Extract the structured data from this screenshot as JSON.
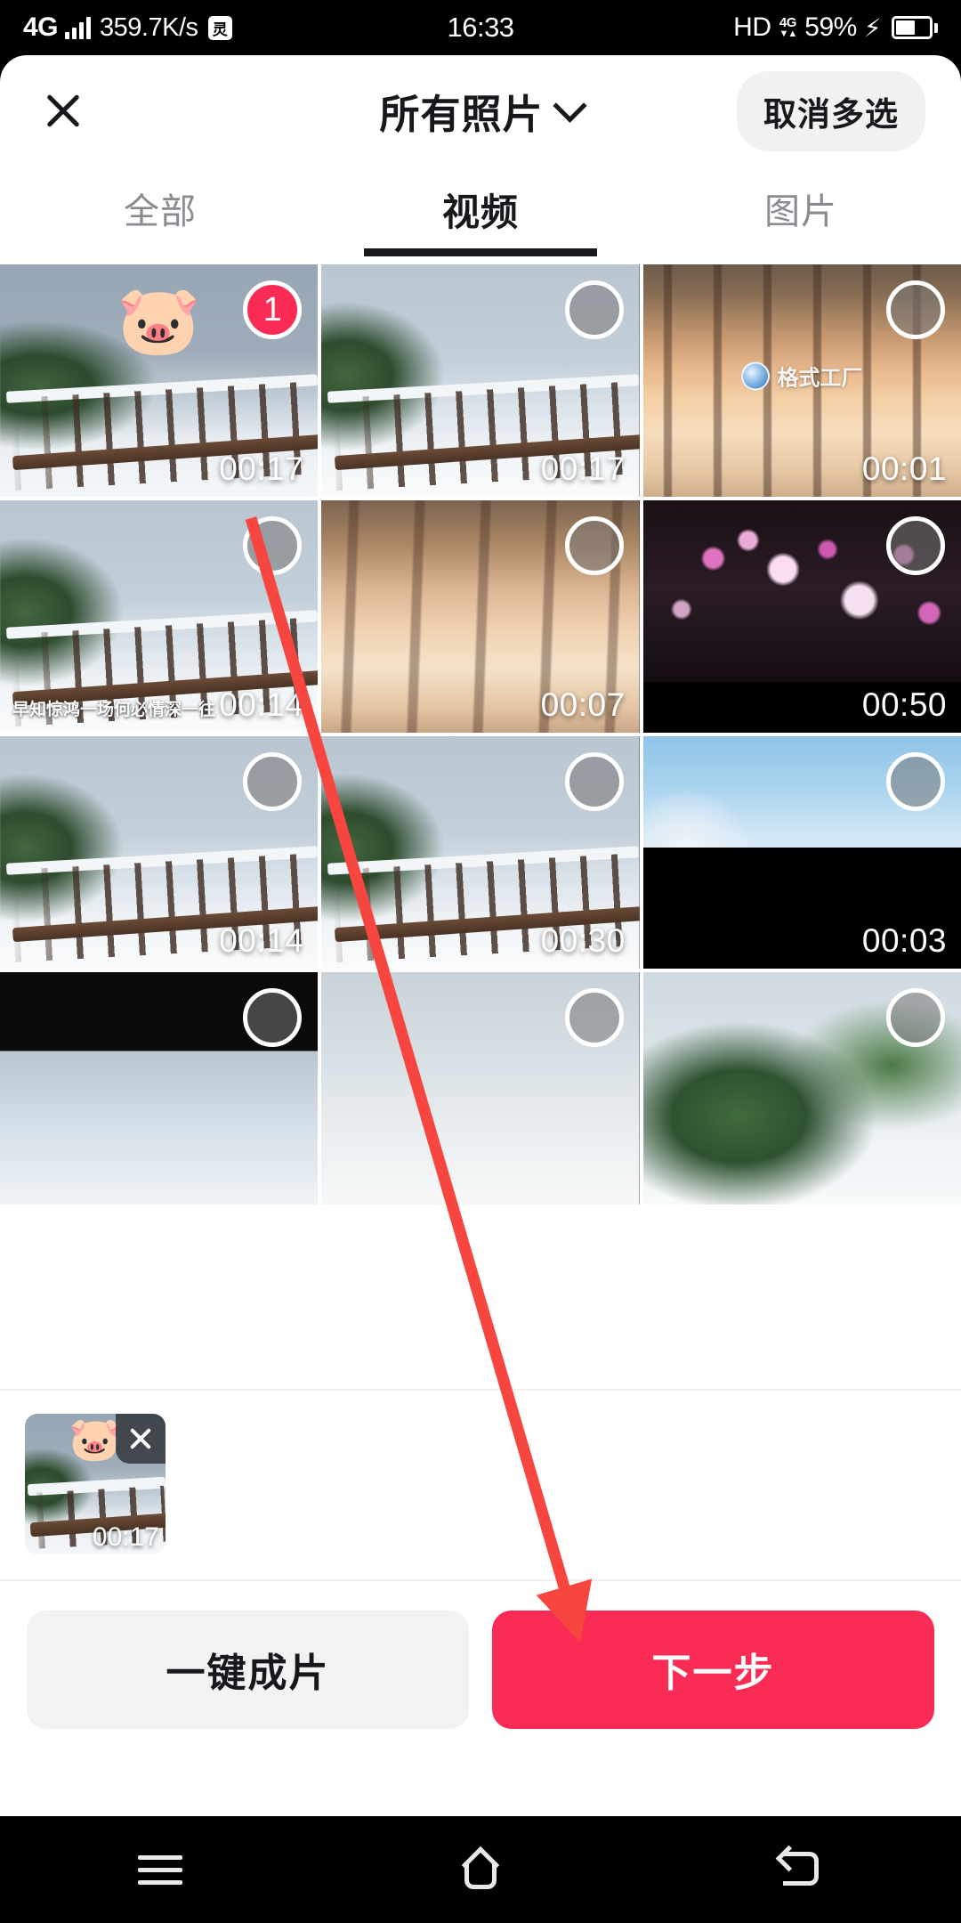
{
  "status_bar": {
    "network_type": "4G",
    "speed": "359.7K/s",
    "app_badge_icon": "ime-badge-icon",
    "time": "16:33",
    "hd_label": "HD",
    "data_label": "4G",
    "battery_percent": "59%",
    "charging": true
  },
  "header": {
    "close_icon": "close-icon",
    "title": "所有照片",
    "dropdown_icon": "chevron-down-icon",
    "cancel_label": "取消多选"
  },
  "tabs": [
    {
      "label": "全部",
      "active": false
    },
    {
      "label": "视频",
      "active": true
    },
    {
      "label": "图片",
      "active": false
    }
  ],
  "grid": {
    "items": [
      {
        "duration": "00:17",
        "selected": true,
        "badge": "1",
        "sticker": "🐷",
        "scene": "sc-snow-deck",
        "deck": true
      },
      {
        "duration": "00:17",
        "selected": false,
        "badge": "",
        "sticker": "",
        "scene": "sc-snow-deck2",
        "deck": true
      },
      {
        "duration": "00:01",
        "selected": false,
        "badge": "",
        "sticker": "",
        "scene": "sc-sunset-trees",
        "watermark": "格式工厂"
      },
      {
        "duration": "00:14",
        "selected": false,
        "badge": "",
        "sticker": "",
        "scene": "sc-snow-deck2",
        "deck": true,
        "caption": "早知惊鸿一场何必情深一往"
      },
      {
        "duration": "00:07",
        "selected": false,
        "badge": "",
        "sticker": "",
        "scene": "sc-sunset-blur"
      },
      {
        "duration": "00:50",
        "selected": false,
        "badge": "",
        "sticker": "",
        "scene": "sc-blossom"
      },
      {
        "duration": "00:14",
        "selected": false,
        "badge": "",
        "sticker": "",
        "scene": "sc-snow-deck2",
        "deck": true
      },
      {
        "duration": "00:30",
        "selected": false,
        "badge": "",
        "sticker": "",
        "scene": "sc-snow-deck2",
        "deck": true
      },
      {
        "duration": "00:03",
        "selected": false,
        "badge": "",
        "sticker": "",
        "scene": "sc-birds"
      },
      {
        "duration": "",
        "selected": false,
        "badge": "",
        "sticker": "",
        "scene": "sc-strip"
      },
      {
        "duration": "",
        "selected": false,
        "badge": "",
        "sticker": "",
        "scene": "sc-strip2"
      },
      {
        "duration": "",
        "selected": false,
        "badge": "",
        "sticker": "",
        "scene": "sc-leaves"
      }
    ]
  },
  "tray": {
    "items": [
      {
        "duration": "00:17",
        "sticker": "🐷",
        "remove_icon": "close-icon",
        "scene": "sc-snow-deck"
      }
    ]
  },
  "actions": {
    "secondary_label": "一键成片",
    "primary_label": "下一步"
  },
  "colors": {
    "accent": "#fa2c55",
    "text_primary": "#16181c",
    "text_muted": "#8a8b90",
    "chip_bg": "#f1f1f2",
    "annotation": "#f6463f"
  },
  "annotation": {
    "type": "arrow",
    "color": "#f6463f",
    "points_to": "下一步"
  },
  "navbar": {
    "menu_icon": "menu-icon",
    "home_icon": "home-icon",
    "back_icon": "back-icon"
  }
}
